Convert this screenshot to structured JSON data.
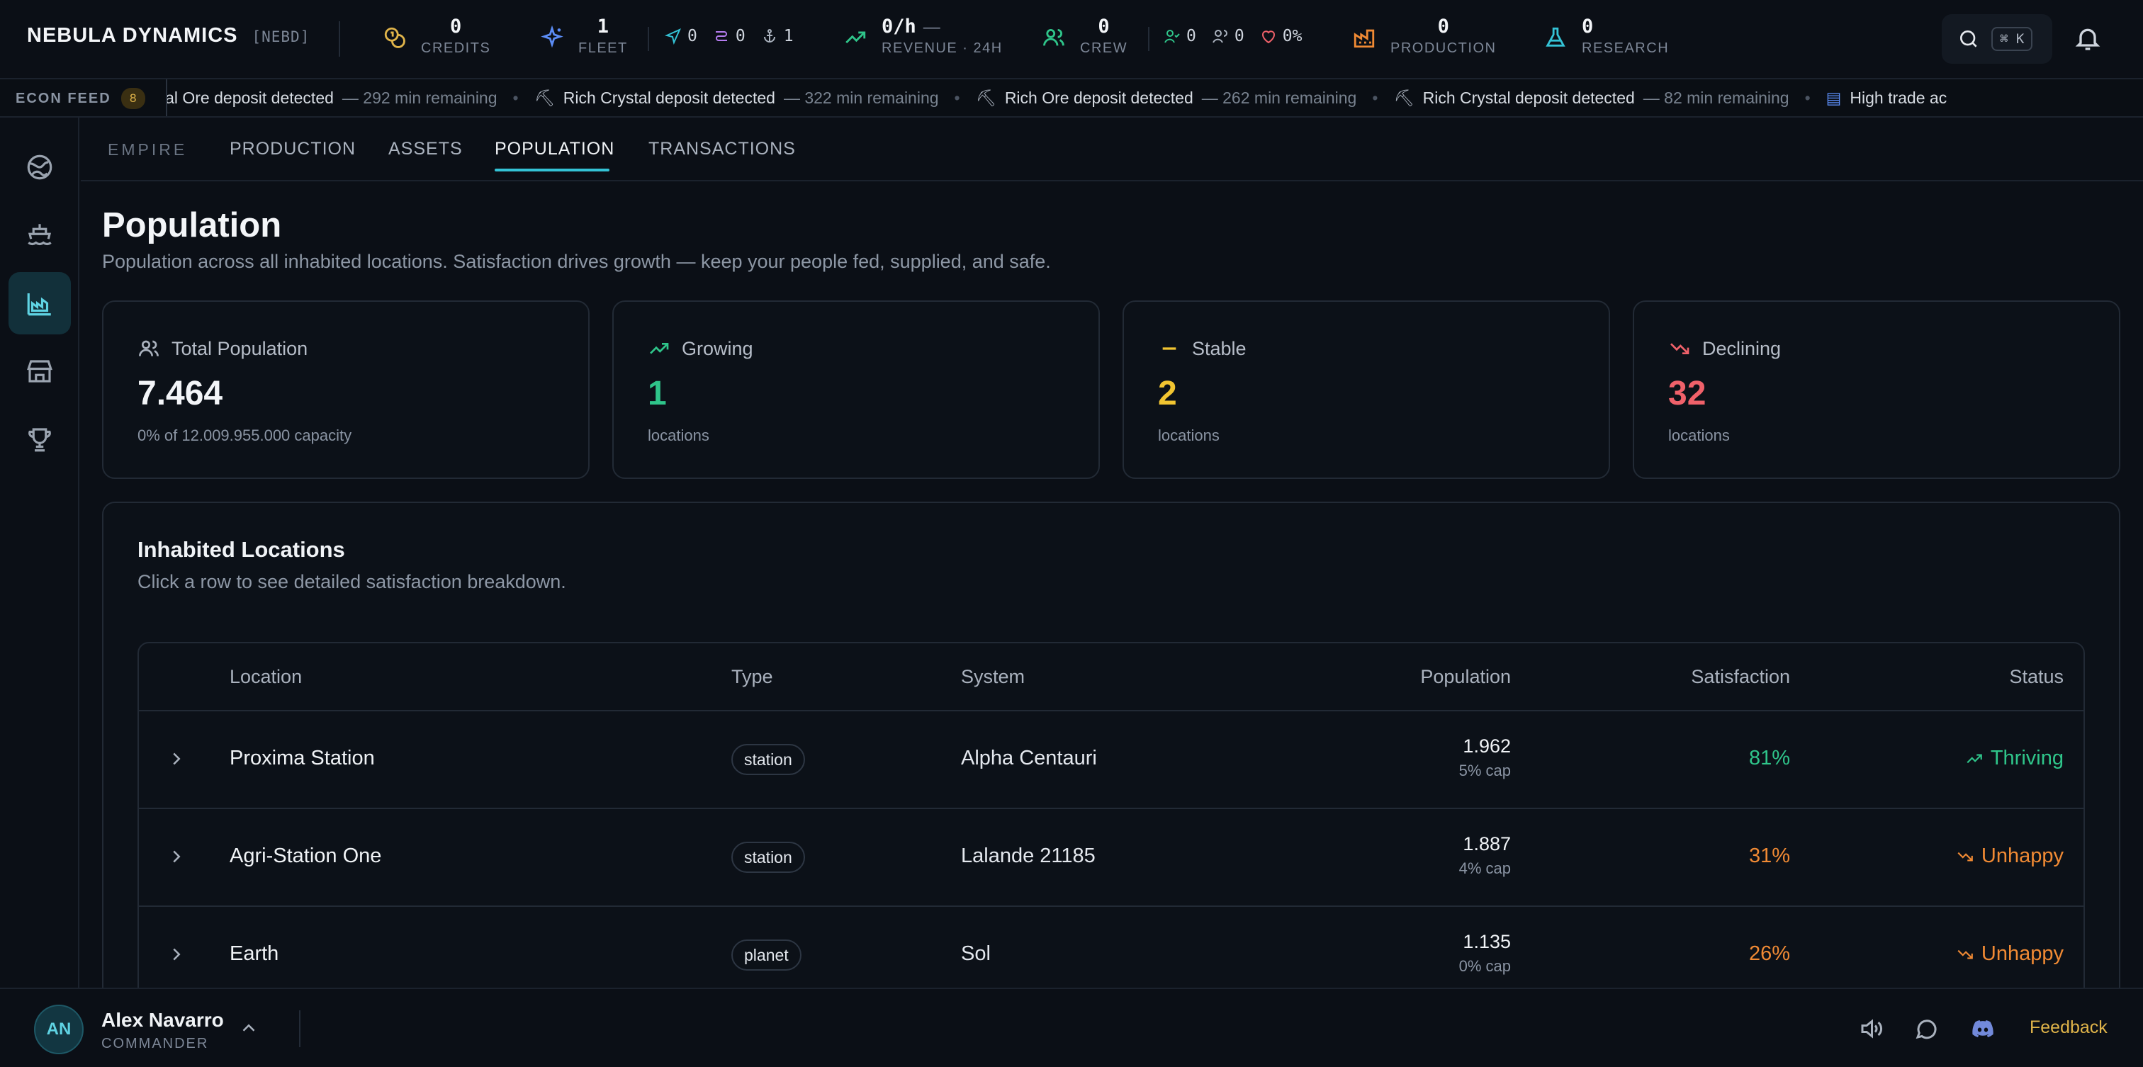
{
  "brand": {
    "name": "NEBULA DYNAMICS",
    "tag": "[NEBD]"
  },
  "stats": {
    "credits": {
      "value": "0",
      "label": "CREDITS"
    },
    "fleet": {
      "value": "1",
      "label": "FLEET"
    },
    "fleet_mini": [
      "0",
      "0",
      "1"
    ],
    "revenue": {
      "value": "0/h",
      "dash": "—",
      "label": "REVENUE · 24H"
    },
    "crew": {
      "value": "0",
      "label": "CREW"
    },
    "crew_mini": [
      "0",
      "0",
      "0%"
    ],
    "production": {
      "value": "0",
      "label": "PRODUCTION"
    },
    "research": {
      "value": "0",
      "label": "RESEARCH"
    }
  },
  "search": {
    "shortcut": "⌘ K"
  },
  "ticker": {
    "label": "ECON FEED",
    "count": "8",
    "items": [
      {
        "msg": "tional Ore deposit detected",
        "rem": "— 292 min remaining"
      },
      {
        "msg": "Rich Crystal deposit detected",
        "rem": "— 322 min remaining"
      },
      {
        "msg": "Rich Ore deposit detected",
        "rem": "— 262 min remaining"
      },
      {
        "msg": "Rich Crystal deposit detected",
        "rem": "— 82 min remaining"
      },
      {
        "msg": "High trade ac",
        "rem": ""
      }
    ]
  },
  "tabs": {
    "section": "EMPIRE",
    "items": [
      "PRODUCTION",
      "ASSETS",
      "POPULATION",
      "TRANSACTIONS"
    ],
    "active": "POPULATION"
  },
  "page": {
    "title": "Population",
    "subtitle": "Population across all inhabited locations. Satisfaction drives growth — keep your people fed, supplied, and safe."
  },
  "cards": {
    "total": {
      "label": "Total Population",
      "value": "7.464",
      "foot": "0% of 12.009.955.000 capacity"
    },
    "growing": {
      "label": "Growing",
      "value": "1",
      "foot": "locations"
    },
    "stable": {
      "label": "Stable",
      "value": "2",
      "foot": "locations"
    },
    "declining": {
      "label": "Declining",
      "value": "32",
      "foot": "locations"
    }
  },
  "colors": {
    "green": "#2fc58a",
    "yellow": "#f2c531",
    "red": "#f0616a",
    "orange": "#f08a34",
    "accent": "#34c3d6"
  },
  "panel": {
    "title": "Inhabited Locations",
    "subtitle": "Click a row to see detailed satisfaction breakdown."
  },
  "table": {
    "headers": {
      "location": "Location",
      "type": "Type",
      "system": "System",
      "population": "Population",
      "satisfaction": "Satisfaction",
      "status": "Status"
    },
    "rows": [
      {
        "location": "Proxima Station",
        "type": "station",
        "system": "Alpha Centauri",
        "population": "1.962",
        "cap": "5% cap",
        "satisfaction": "81%",
        "status": "Thriving"
      },
      {
        "location": "Agri-Station One",
        "type": "station",
        "system": "Lalande 21185",
        "population": "1.887",
        "cap": "4% cap",
        "satisfaction": "31%",
        "status": "Unhappy"
      },
      {
        "location": "Earth",
        "type": "planet",
        "system": "Sol",
        "population": "1.135",
        "cap": "0% cap",
        "satisfaction": "26%",
        "status": "Unhappy"
      }
    ]
  },
  "user": {
    "initials": "AN",
    "name": "Alex Navarro",
    "role": "COMMANDER"
  },
  "footer": {
    "feedback": "Feedback"
  }
}
